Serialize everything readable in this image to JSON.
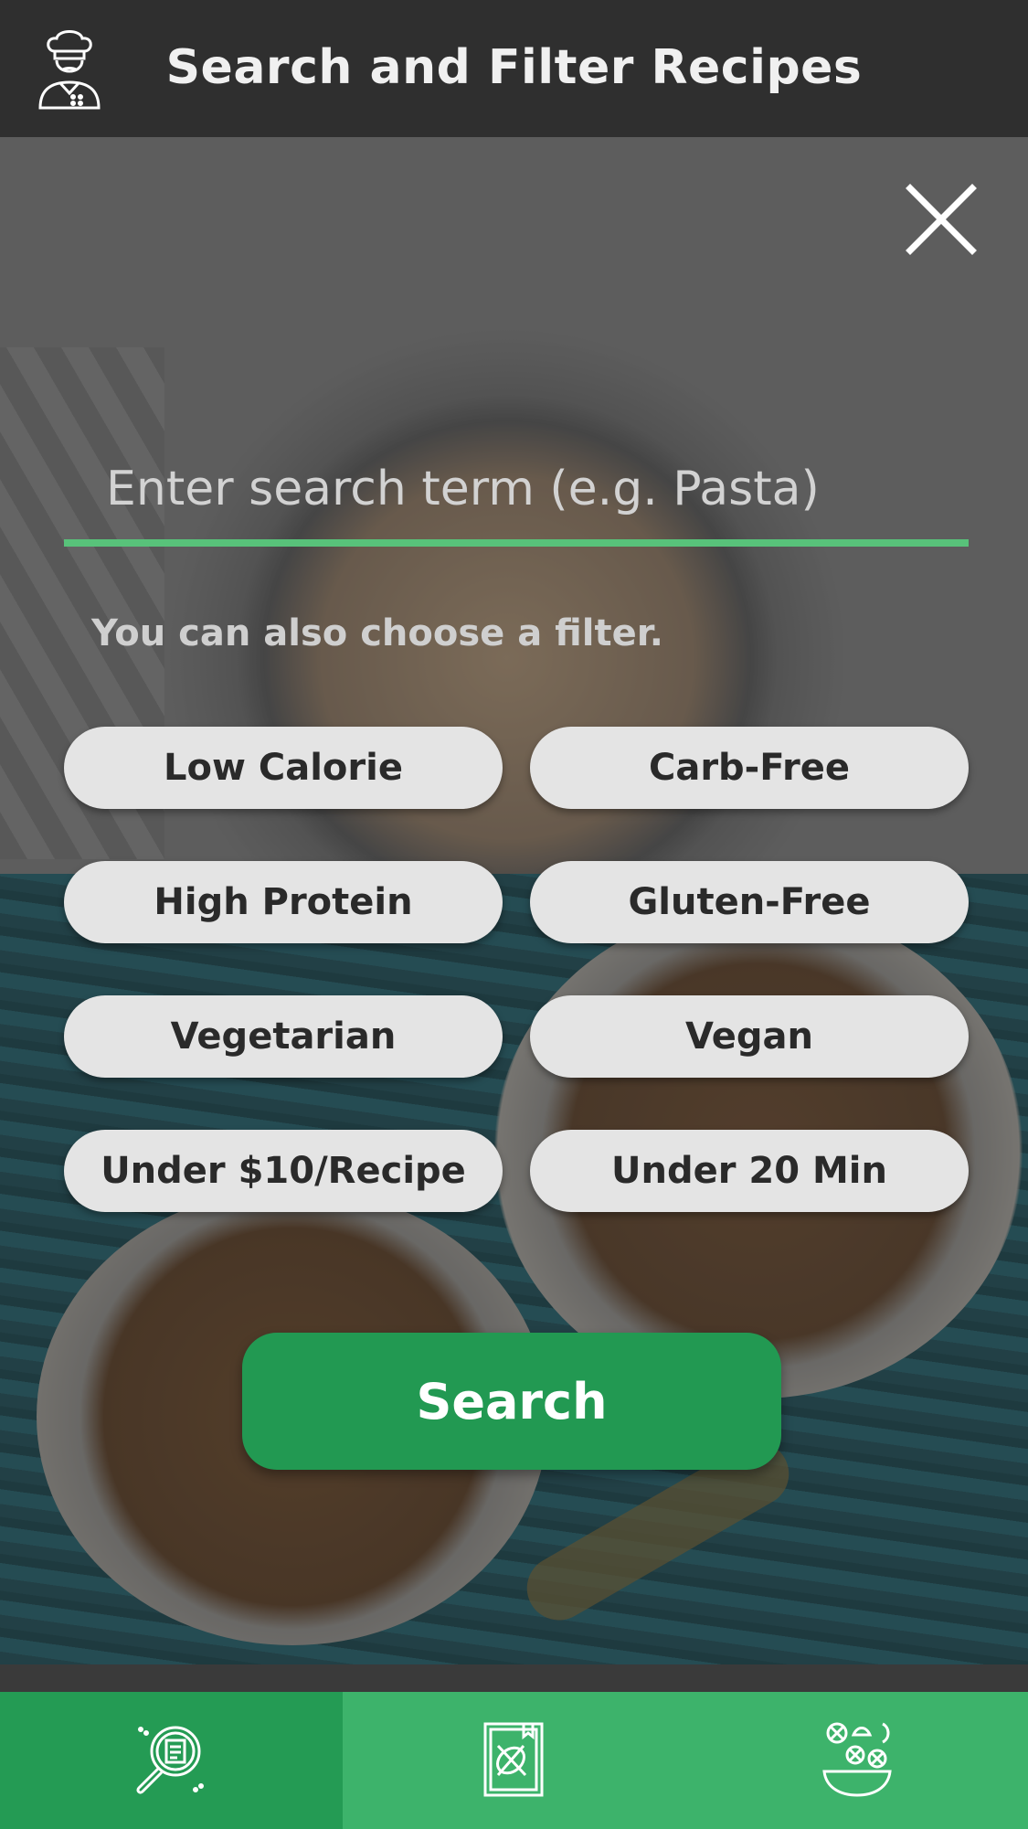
{
  "header": {
    "title": "Search and Filter Recipes",
    "logo_icon": "chef-icon"
  },
  "close_icon": "close-icon",
  "search": {
    "placeholder": "Enter search term (e.g. Pasta)",
    "value": ""
  },
  "hint": "You can also choose a filter.",
  "filters": [
    {
      "label": "Low Calorie"
    },
    {
      "label": "Carb-Free"
    },
    {
      "label": "High Protein"
    },
    {
      "label": "Gluten-Free"
    },
    {
      "label": "Vegetarian"
    },
    {
      "label": "Vegan"
    },
    {
      "label": "Under $10/Recipe"
    },
    {
      "label": "Under 20 Min"
    }
  ],
  "search_button": "Search",
  "nav": [
    {
      "icon": "recipe-search-icon",
      "active": true
    },
    {
      "icon": "recipe-book-icon",
      "active": false
    },
    {
      "icon": "ingredients-bowl-icon",
      "active": false
    }
  ],
  "colors": {
    "accent": "#229952",
    "nav": "#3db36b",
    "nav_active": "#249b54",
    "underline": "#58c27a",
    "header": "#2f2f2f"
  }
}
